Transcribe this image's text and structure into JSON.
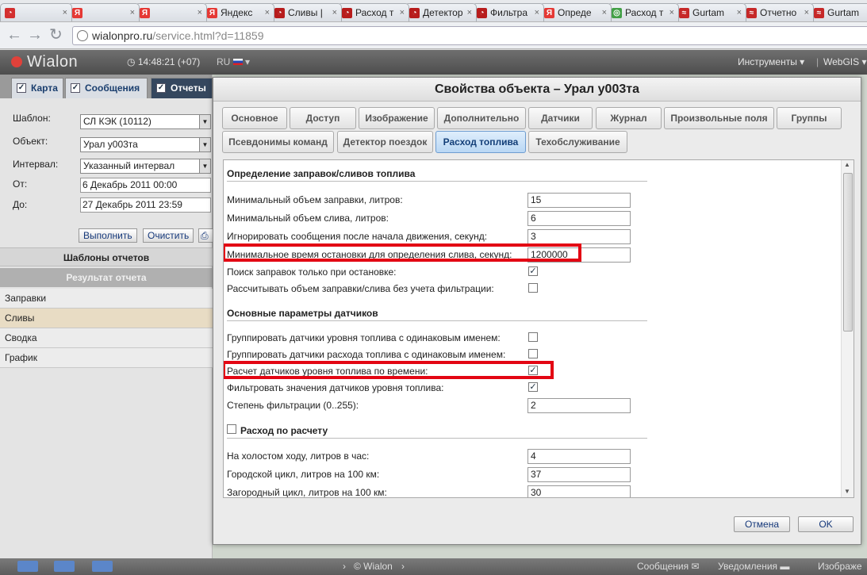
{
  "browser": {
    "tabs": [
      {
        "label": "",
        "color": "#d32f2f",
        "glyph": "◔"
      },
      {
        "label": "",
        "color": "#e53935",
        "glyph": "Я"
      },
      {
        "label": "",
        "color": "#e53935",
        "glyph": "Я"
      },
      {
        "label": "Яндекс",
        "color": "#e53935",
        "glyph": "Я"
      },
      {
        "label": "Сливы |",
        "color": "#b71c1c",
        "glyph": "◔"
      },
      {
        "label": "Расход т",
        "color": "#b71c1c",
        "glyph": "◔"
      },
      {
        "label": "Детектор",
        "color": "#b71c1c",
        "glyph": "◔"
      },
      {
        "label": "Фильтра",
        "color": "#b71c1c",
        "glyph": "◔"
      },
      {
        "label": "Опреде",
        "color": "#e53935",
        "glyph": "Я"
      },
      {
        "label": "Расход т",
        "color": "#43a047",
        "glyph": "◎"
      },
      {
        "label": "Gurtam",
        "color": "#c62828",
        "glyph": "≈"
      },
      {
        "label": "Отчетно",
        "color": "#c62828",
        "glyph": "≈"
      },
      {
        "label": "Gurtam",
        "color": "#c62828",
        "glyph": "≈"
      }
    ],
    "url_host": "wialonpro.ru",
    "url_path": "/service.html?d=11859"
  },
  "app": {
    "logo": "Wialon",
    "clock": "14:48:21 (+07)",
    "lang": "RU",
    "tools_menu": "Инструменты",
    "webgis_menu": "WebGIS"
  },
  "left": {
    "tabs": [
      "Карта",
      "Сообщения",
      "Отчеты"
    ],
    "template_label": "Шаблон:",
    "template_value": "СЛ КЭК (10112)",
    "object_label": "Объект:",
    "object_value": "Урал у003та",
    "interval_label": "Интервал:",
    "interval_value": "Указанный интервал",
    "from_label": "От:",
    "from_value": "6 Декабрь 2011 00:00",
    "to_label": "До:",
    "to_value": "27 Декабрь 2011 23:59",
    "run_button": "Выполнить",
    "clear_button": "Очистить",
    "templates_header": "Шаблоны отчетов",
    "result_header": "Результат отчета",
    "result_items": [
      "Заправки",
      "Сливы",
      "Сводка",
      "График"
    ]
  },
  "dialog": {
    "title": "Свойства объекта – Урал у003та",
    "tabs_row1": [
      "Основное",
      "Доступ",
      "Изображение",
      "Дополнительно",
      "Датчики",
      "Журнал",
      "Произвольные поля",
      "Группы"
    ],
    "tabs_row2": [
      "Псевдонимы команд",
      "Детектор поездок",
      "Расход топлива",
      "Техобслуживание"
    ],
    "section1": "Определение заправок/сливов топлива",
    "params1": [
      {
        "label": "Минимальный объем заправки, литров:",
        "value": "15"
      },
      {
        "label": "Минимальный объем слива, литров:",
        "value": "6"
      },
      {
        "label": "Игнорировать сообщения после начала движения, секунд:",
        "value": "3"
      },
      {
        "label": "Минимальное время остановки для определения слива, секунд:",
        "value": "1200000"
      }
    ],
    "checks1": [
      {
        "label": "Поиск заправок только при остановке:",
        "mark": "✓"
      },
      {
        "label": "Рассчитывать объем заправки/слива без учета фильтрации:",
        "mark": ""
      }
    ],
    "section2": "Основные параметры датчиков",
    "checks2": [
      {
        "label": "Группировать датчики уровня топлива с одинаковым именем:",
        "mark": ""
      },
      {
        "label": "Группировать датчики расхода топлива с одинаковым именем:",
        "mark": ""
      },
      {
        "label": "Расчет датчиков уровня топлива по времени:",
        "mark": "✓"
      },
      {
        "label": "Фильтровать значения датчиков уровня топлива:",
        "mark": "✓"
      }
    ],
    "filter_label": "Степень фильтрации (0..255):",
    "filter_value": "2",
    "section3": "Расход по расчету",
    "params3": [
      {
        "label": "На холостом ходу, литров в час:",
        "value": "4"
      },
      {
        "label": "Городской цикл, литров на 100 км:",
        "value": "37"
      },
      {
        "label": "Загородный цикл, литров на 100 км:",
        "value": "30"
      }
    ],
    "cancel_button": "Отмена",
    "ok_button": "OK"
  },
  "footer": {
    "wialon": "© Wialon",
    "messages": "Сообщения",
    "notifications": "Уведомления",
    "images": "Изображе"
  },
  "colors": {
    "highlight": "#e30613",
    "active_tab": "#35475e",
    "selected_item": "#e8dcc4"
  }
}
